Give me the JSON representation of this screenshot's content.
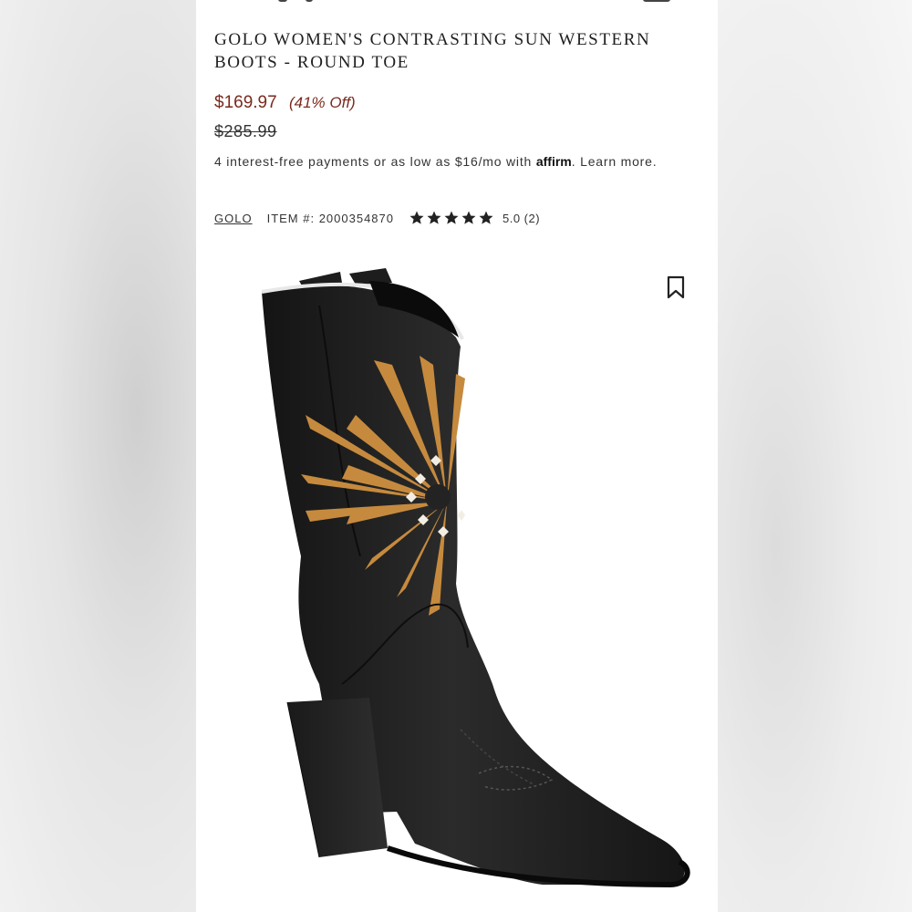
{
  "product": {
    "title": "GOLO WOMEN'S CONTRASTING SUN WESTERN BOOTS - ROUND TOE",
    "sale_price": "$169.97",
    "discount": "(41% Off)",
    "original_price": "$285.99",
    "payments_text": "4 interest-free payments or as low as $16/mo with",
    "affirm_logo": "affirm",
    "learn_more": "Learn more.",
    "brand": "GOLO",
    "item_label": "ITEM #: 2000354870",
    "rating": "5.0 (2)",
    "stars": 5,
    "wishlist_icon": "bookmark-icon",
    "image_icon": "western-boot-photo"
  },
  "colors": {
    "price": "#7a2a1e",
    "text": "#333333",
    "star": "#222222"
  }
}
